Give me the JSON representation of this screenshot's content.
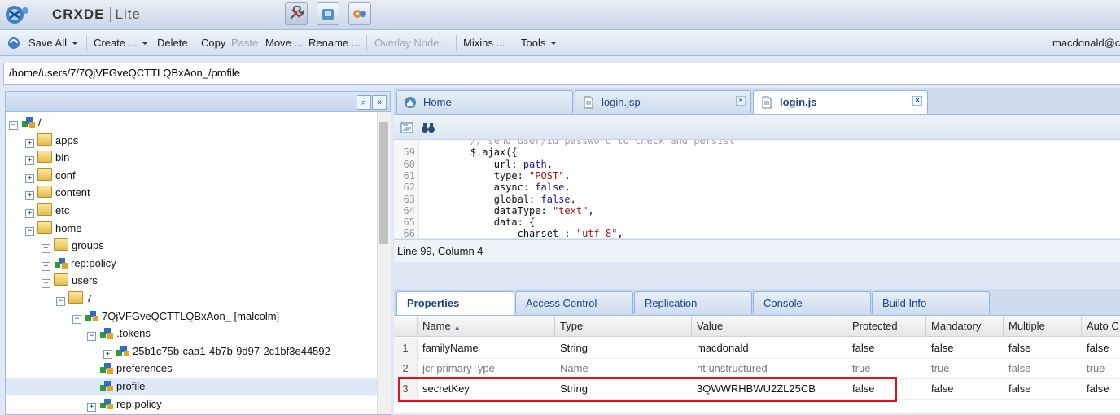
{
  "app": {
    "name": "CRXDE",
    "edition": "Lite"
  },
  "mode_buttons": [
    {
      "icon": "wrench-icon"
    },
    {
      "icon": "package-icon"
    },
    {
      "icon": "gears-icon"
    }
  ],
  "toolbar": {
    "save_all": "Save All",
    "create": "Create ...",
    "delete": "Delete",
    "copy": "Copy",
    "paste": "Paste",
    "move": "Move ...",
    "rename": "Rename ...",
    "overlay": "Overlay Node ...",
    "mixins": "Mixins ...",
    "tools": "Tools",
    "user": "macdonald@c"
  },
  "path": "/home/users/7/7QjVFGveQCTTLQBxAon_/profile",
  "tree": [
    {
      "label": "/",
      "toggle": "−",
      "icon": "node"
    },
    {
      "label": "apps",
      "toggle": "+",
      "icon": "folder"
    },
    {
      "label": "bin",
      "toggle": "+",
      "icon": "folder"
    },
    {
      "label": "conf",
      "toggle": "+",
      "icon": "folder"
    },
    {
      "label": "content",
      "toggle": "+",
      "icon": "folder"
    },
    {
      "label": "etc",
      "toggle": "+",
      "icon": "folder"
    },
    {
      "label": "home",
      "toggle": "−",
      "icon": "folder"
    },
    {
      "label": "groups",
      "toggle": "+",
      "icon": "folder"
    },
    {
      "label": "rep:policy",
      "toggle": "+",
      "icon": "node"
    },
    {
      "label": "users",
      "toggle": "−",
      "icon": "folder"
    },
    {
      "label": "7",
      "toggle": "−",
      "icon": "folder"
    },
    {
      "label": "7QjVFGveQCTTLQBxAon_ [malcolm]",
      "toggle": "−",
      "icon": "node"
    },
    {
      "label": ".tokens",
      "toggle": "−",
      "icon": "node"
    },
    {
      "label": "25b1c75b-caa1-4b7b-9d97-2c1bf3e44592",
      "toggle": "+",
      "icon": "node"
    },
    {
      "label": "preferences",
      "toggle": "",
      "icon": "node"
    },
    {
      "label": "profile",
      "toggle": "",
      "icon": "node"
    },
    {
      "label": "rep:policy",
      "toggle": "+",
      "icon": "node"
    }
  ],
  "editor_tabs": [
    {
      "label": "Home",
      "icon": "home-icon",
      "closable": false
    },
    {
      "label": "login.jsp",
      "icon": "file-icon",
      "closable": true
    },
    {
      "label": "login.js",
      "icon": "file-icon",
      "closable": true
    }
  ],
  "code": {
    "lines": [
      {
        "n": "",
        "text": "        // send user/id password to check and persist"
      },
      {
        "n": "59",
        "text": "        $.ajax({"
      },
      {
        "n": "60",
        "text": "            url: path,"
      },
      {
        "n": "61",
        "text": "            type: \"POST\","
      },
      {
        "n": "62",
        "text": "            async: false,"
      },
      {
        "n": "63",
        "text": "            global: false,"
      },
      {
        "n": "64",
        "text": "            dataType: \"text\","
      },
      {
        "n": "65",
        "text": "            data: {"
      },
      {
        "n": "66",
        "text": "                charset : \"utf-8\","
      }
    ]
  },
  "status": "Line 99, Column 4",
  "property_tabs": [
    "Properties",
    "Access Control",
    "Replication",
    "Console",
    "Build Info"
  ],
  "properties": {
    "columns": [
      "Name",
      "Type",
      "Value",
      "Protected",
      "Mandatory",
      "Multiple",
      "Auto C"
    ],
    "sort_indicator": "▲",
    "rows": [
      {
        "num": "1",
        "cells": [
          "familyName",
          "String",
          "macdonald",
          "false",
          "false",
          "false",
          "false"
        ],
        "inherited": false
      },
      {
        "num": "2",
        "cells": [
          "jcr:primaryType",
          "Name",
          "nt:unstructured",
          "true",
          "true",
          "false",
          "true"
        ],
        "inherited": true
      },
      {
        "num": "3",
        "cells": [
          "secretKey",
          "String",
          "3QWWRHBWU2ZL25CB",
          "false",
          "false",
          "false",
          "false"
        ],
        "inherited": false
      }
    ]
  },
  "colors": {
    "highlight": "#e1121c",
    "accent": "#15428b",
    "panel_border": "#99bbe8"
  }
}
